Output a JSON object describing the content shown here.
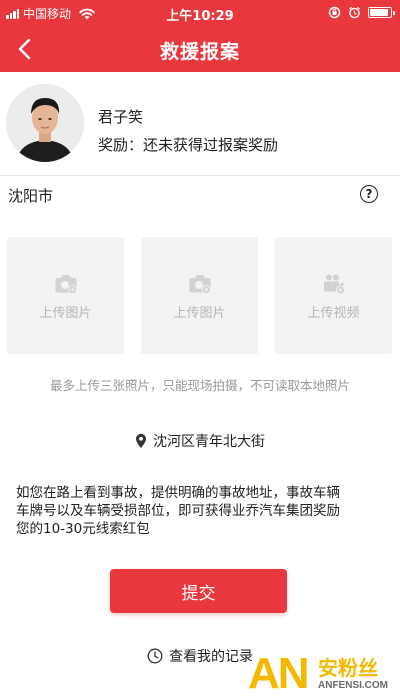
{
  "status_bar": {
    "carrier": "中国移动",
    "time": "上午10:29",
    "battery_level": 0.9
  },
  "header": {
    "title": "救援报案",
    "back_icon": "chevron-left-icon"
  },
  "profile": {
    "name": "君子笑",
    "reward_text": "奖励：还未获得过报案奖励"
  },
  "city": {
    "name": "沈阳市",
    "help_icon": "question-circle-icon",
    "help_glyph": "?"
  },
  "uploads": [
    {
      "label": "上传图片",
      "icon": "camera-plus-icon"
    },
    {
      "label": "上传图片",
      "icon": "camera-plus-icon"
    },
    {
      "label": "上传视频",
      "icon": "video-plus-icon"
    }
  ],
  "upload_hint": "最多上传三张照片，只能现场拍摄，不可读取本地照片",
  "location": {
    "address": "沈河区青年北大街",
    "icon": "location-pin-icon"
  },
  "description": {
    "line1": "如您在路上看到事故，提供明确的事故地址，事故车辆",
    "line2": "车牌号以及车辆受损部位，即可获得业乔汽车集团奖励",
    "line3": "您的10-30元线索红包"
  },
  "submit_label": "提交",
  "records": {
    "label": "查看我的记录",
    "icon": "clock-icon"
  },
  "watermark": {
    "logo_letters": "AN",
    "brand": "安粉丝",
    "domain": "ANFENSI.COM"
  },
  "colors": {
    "brand_red": "#e8383d",
    "tile_bg": "#f3f3f3",
    "hint_gray": "#999999",
    "watermark_gold": "#f5b800"
  }
}
